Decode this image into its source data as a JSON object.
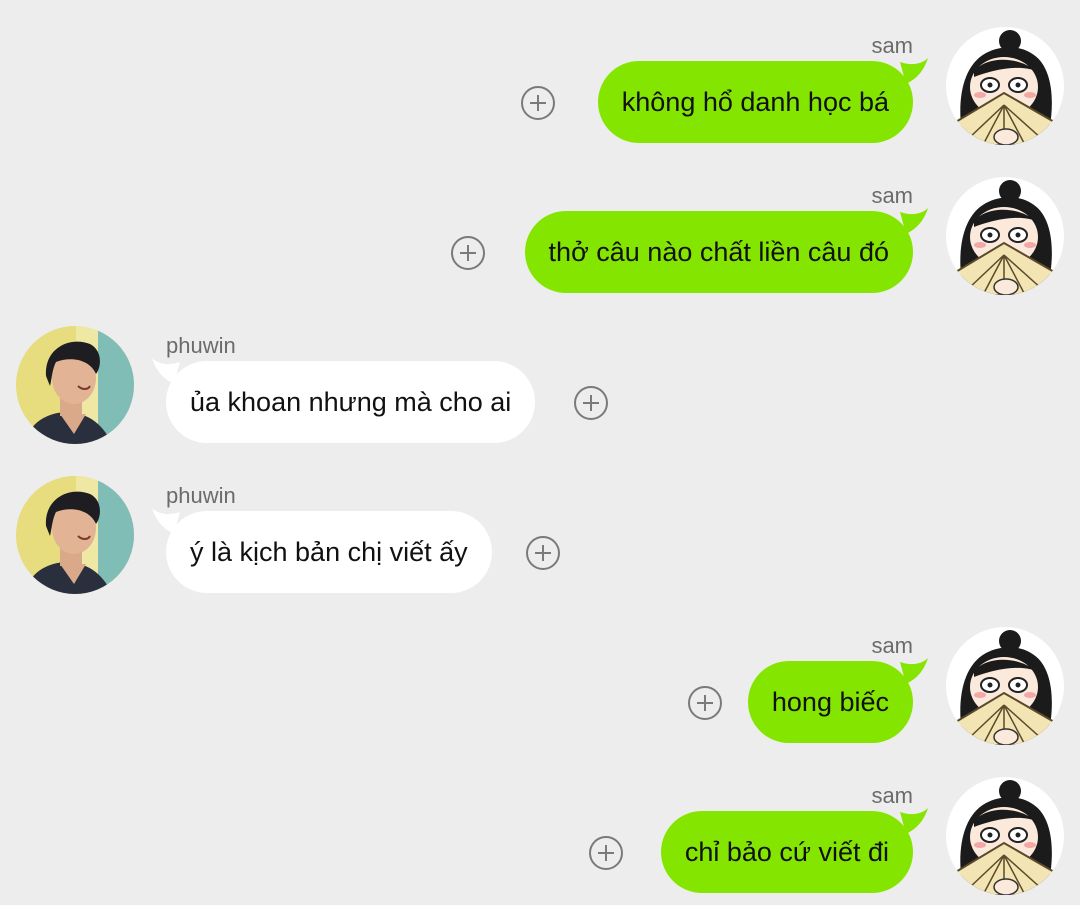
{
  "colors": {
    "background": "#ededed",
    "sent_bubble": "#84e600",
    "received_bubble": "#ffffff",
    "name_text": "#6b6b6b"
  },
  "icons": {
    "add": "plus-circle-icon"
  },
  "messages": [
    {
      "sender": "sam",
      "side": "right",
      "text": "không hổ danh học bá"
    },
    {
      "sender": "sam",
      "side": "right",
      "text": "thở câu nào chất liền câu đó"
    },
    {
      "sender": "phuwin",
      "side": "left",
      "text": "ủa khoan nhưng mà cho ai"
    },
    {
      "sender": "phuwin",
      "side": "left",
      "text": "ý là kịch bản chị viết ấy"
    },
    {
      "sender": "sam",
      "side": "right",
      "text": "hong biếc"
    },
    {
      "sender": "sam",
      "side": "right",
      "text": "chỉ bảo cứ viết đi"
    }
  ]
}
